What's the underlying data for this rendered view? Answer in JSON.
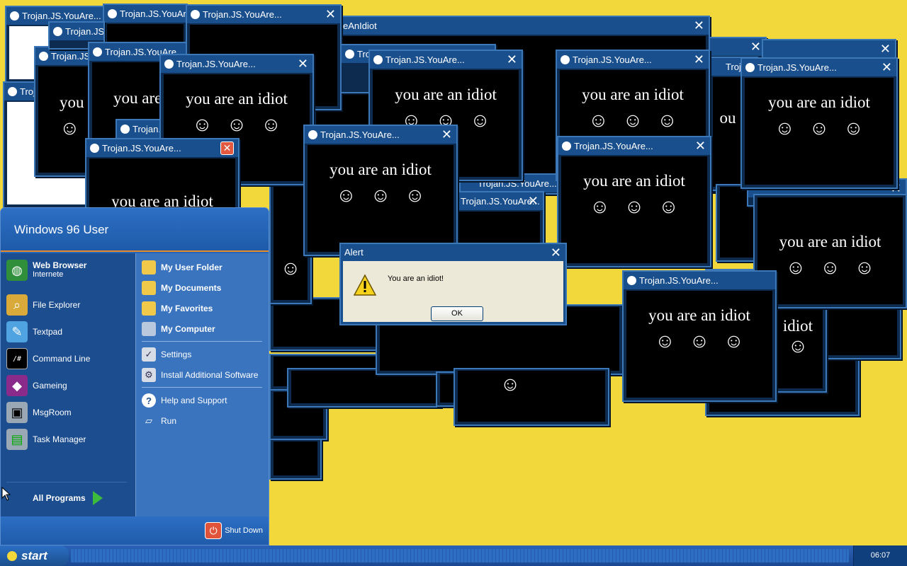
{
  "popups": {
    "title": "Trojan.JS.YouAre...",
    "title_wide": "eAnIdiot",
    "message": "you are an idiot",
    "message_cut1": "you",
    "message_cut2": "you are",
    "message_cut3": "ou a",
    "message_cut4": "idiot",
    "face": "☺☺☺"
  },
  "alert": {
    "title": "Alert",
    "message": "You are an idiot!",
    "ok_label": "OK"
  },
  "start_menu": {
    "user_name": "Windows 96 User",
    "pinned": [
      {
        "label": "Web Browser",
        "sub": "Internete"
      },
      {
        "label": "File Explorer"
      },
      {
        "label": "Textpad"
      },
      {
        "label": "Command Line"
      },
      {
        "label": "Gameing"
      },
      {
        "label": "MsgRoom"
      },
      {
        "label": "Task Manager"
      }
    ],
    "all_programs": "All Programs",
    "right": [
      {
        "label": "My User Folder"
      },
      {
        "label": "My Documents"
      },
      {
        "label": "My Favorites"
      },
      {
        "label": "My Computer"
      },
      {
        "label": "Settings"
      },
      {
        "label": "Install Additional Software"
      },
      {
        "label": "Help and Support"
      },
      {
        "label": "Run"
      }
    ],
    "shutdown": "Shut Down"
  },
  "taskbar": {
    "start_label": "start",
    "clock": "06:07"
  }
}
